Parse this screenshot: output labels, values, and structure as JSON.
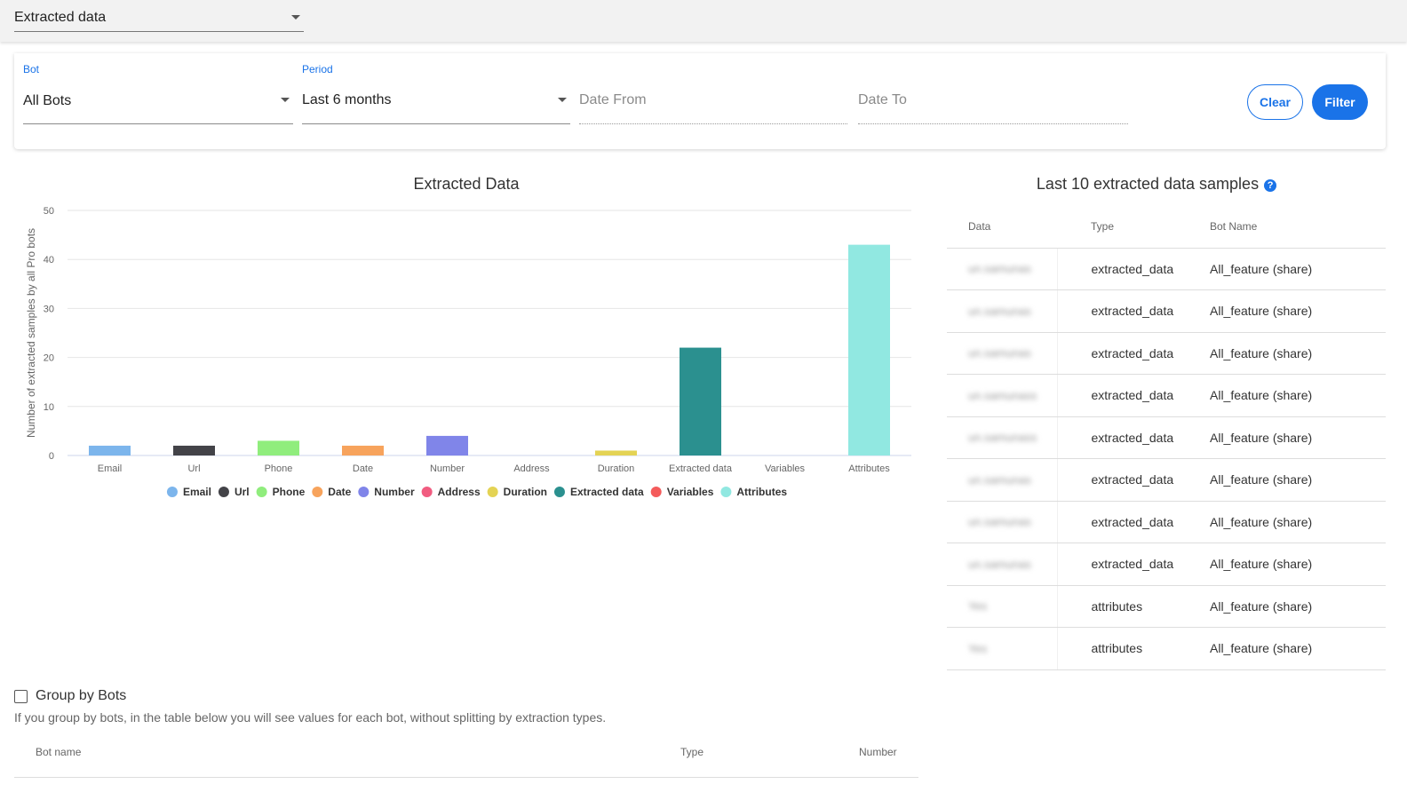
{
  "topbar": {
    "report_select": "Extracted data"
  },
  "filters": {
    "bot": {
      "label": "Bot",
      "value": "All Bots"
    },
    "period": {
      "label": "Period",
      "value": "Last 6 months"
    },
    "date_from": {
      "placeholder": "Date From"
    },
    "date_to": {
      "placeholder": "Date To"
    },
    "clear_label": "Clear",
    "filter_label": "Filter"
  },
  "chart_data": {
    "type": "bar",
    "title": "Extracted Data",
    "ylabel": "Number of extracted samples by all Pro bots",
    "xlabel": "",
    "ylim": [
      0,
      50
    ],
    "yticks": [
      0,
      10,
      20,
      30,
      40,
      50
    ],
    "grid": true,
    "legend_position": "bottom",
    "categories": [
      "Email",
      "Url",
      "Phone",
      "Date",
      "Number",
      "Address",
      "Duration",
      "Extracted data",
      "Variables",
      "Attributes"
    ],
    "values": [
      2,
      2,
      3,
      2,
      4,
      0,
      1,
      22,
      0,
      43
    ],
    "colors": [
      "#7cb5ec",
      "#434348",
      "#90ed7d",
      "#f7a35c",
      "#8085e9",
      "#f15c80",
      "#e4d354",
      "#2b908f",
      "#f45b5b",
      "#91e8e1"
    ]
  },
  "samples": {
    "title": "Last 10 extracted data samples",
    "columns": [
      "Data",
      "Type",
      "Bot Name"
    ],
    "rows": [
      [
        "un.samunas",
        "extracted_data",
        "All_feature (share)"
      ],
      [
        "un.samunas",
        "extracted_data",
        "All_feature (share)"
      ],
      [
        "un.samunas",
        "extracted_data",
        "All_feature (share)"
      ],
      [
        "un.samunass",
        "extracted_data",
        "All_feature (share)"
      ],
      [
        "un.samunass",
        "extracted_data",
        "All_feature (share)"
      ],
      [
        "un.samunas",
        "extracted_data",
        "All_feature (share)"
      ],
      [
        "un.samunas",
        "extracted_data",
        "All_feature (share)"
      ],
      [
        "un.samunas",
        "extracted_data",
        "All_feature (share)"
      ],
      [
        "Yes",
        "attributes",
        "All_feature (share)"
      ],
      [
        "Yes",
        "attributes",
        "All_feature (share)"
      ]
    ]
  },
  "group": {
    "label": "Group by Bots",
    "checked": false,
    "hint": "If you group by bots, in the table below you will see values for each bot, without splitting by extraction types."
  },
  "bots_table": {
    "columns": [
      "Bot name",
      "Type",
      "Number"
    ]
  }
}
